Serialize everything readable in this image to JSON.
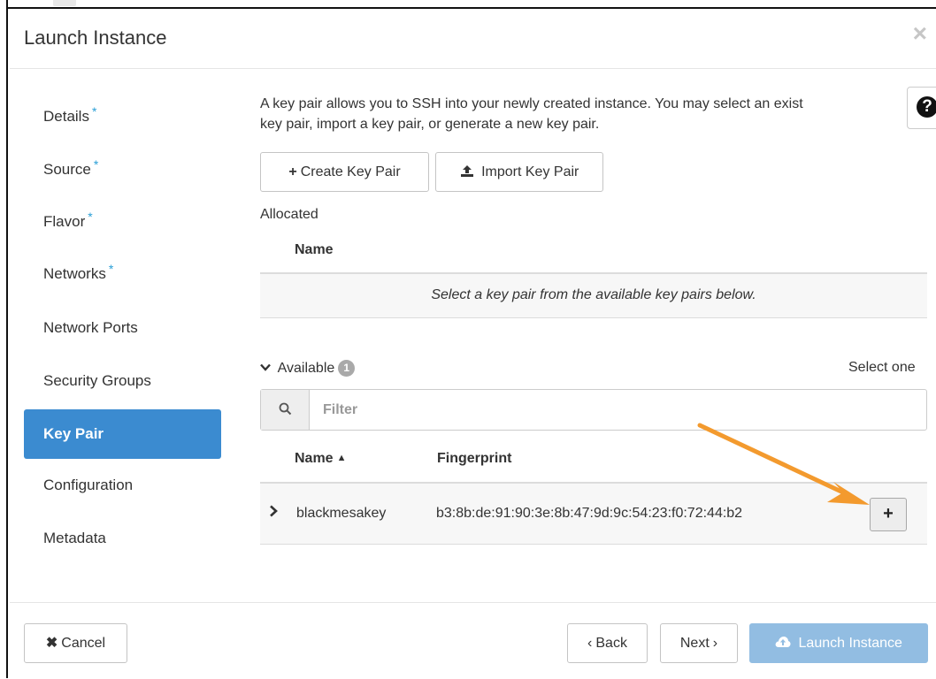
{
  "modal": {
    "title": "Launch Instance",
    "close_glyph": "×"
  },
  "sidebar": {
    "items": [
      {
        "label": "Details",
        "required": "*"
      },
      {
        "label": "Source",
        "required": "*"
      },
      {
        "label": "Flavor",
        "required": "*"
      },
      {
        "label": "Networks",
        "required": "*"
      },
      {
        "label": "Network Ports"
      },
      {
        "label": "Security Groups"
      },
      {
        "label": "Key Pair"
      },
      {
        "label": "Configuration"
      },
      {
        "label": "Metadata"
      }
    ],
    "active": "Key Pair"
  },
  "content": {
    "description_line1": "A key pair allows you to SSH into your newly created instance. You may select an exist",
    "description_line2": "key pair, import a key pair, or generate a new key pair.",
    "help_glyph": "?",
    "create_button": "Create Key Pair",
    "import_button": "Import Key Pair",
    "allocated_label": "Allocated",
    "allocated_column": "Name",
    "allocated_empty": "Select a key pair from the available key pairs below.",
    "available_label": "Available",
    "available_count": "1",
    "select_one": "Select one",
    "filter_placeholder": "Filter",
    "columns": {
      "name": "Name",
      "fingerprint": "Fingerprint"
    },
    "rows": [
      {
        "name": "blackmesakey",
        "fingerprint": "b3:8b:de:91:90:3e:8b:47:9d:9c:54:23:f0:72:44:b2",
        "action": "+"
      }
    ]
  },
  "footer": {
    "cancel": "Cancel",
    "back": "Back",
    "next": "Next",
    "launch": "Launch Instance"
  },
  "colors": {
    "active_nav": "#3b8bd0",
    "required_star": "#2a9fd6",
    "launch_button": "#92bde2",
    "annotation_arrow": "#f39a2e"
  },
  "icons": {
    "create": "plus-icon",
    "import": "upload-icon",
    "search": "search-icon",
    "cancel": "x-icon",
    "launch": "cloud-upload-icon"
  }
}
